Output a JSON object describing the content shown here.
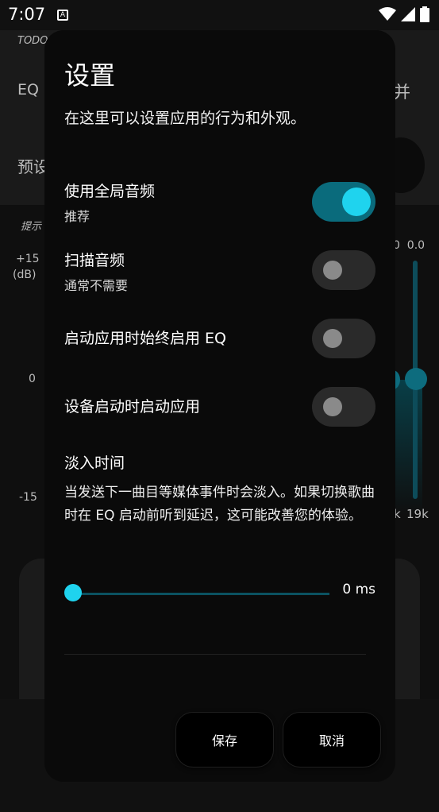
{
  "status_bar": {
    "time": "7:07",
    "notification_icon_label": "A"
  },
  "background": {
    "top_label": "TODO",
    "eq_label": "EQ",
    "right_label": "并",
    "preset_label": "预设",
    "hint_label": "提示",
    "db_top": "+15",
    "db_unit": "(dB)",
    "db_mid": "0",
    "db_bottom": "-15",
    "freq_values_top": "0  0.0",
    "freq_bottom_left": "k",
    "freq_bottom_right": "19k"
  },
  "dialog": {
    "title": "设置",
    "description": "在这里可以设置应用的行为和外观。",
    "settings": [
      {
        "label": "使用全局音频",
        "sub": "推荐",
        "enabled": true
      },
      {
        "label": "扫描音频",
        "sub": "通常不需要",
        "enabled": false
      },
      {
        "label": "启动应用时始终启用 EQ",
        "sub": "",
        "enabled": false
      },
      {
        "label": "设备启动时启动应用",
        "sub": "",
        "enabled": false
      }
    ],
    "fade": {
      "title": "淡入时间",
      "description": "当发送下一曲目等媒体事件时会淡入。如果切换歌曲时在 EQ 启动前听到延迟，这可能改善您的体验。",
      "value_text": "0 ms",
      "value_fraction": 0
    },
    "buttons": {
      "save": "保存",
      "cancel": "取消"
    }
  },
  "colors": {
    "accent": "#1fd3ee",
    "toggle_on_track": "#0a6b7c",
    "dialog_bg": "#0a0a0a"
  }
}
